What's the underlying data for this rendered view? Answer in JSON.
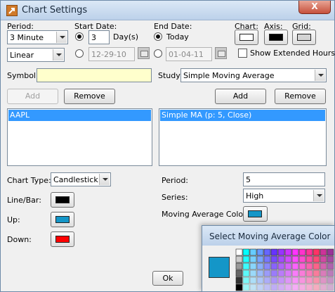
{
  "window": {
    "title": "Chart Settings",
    "close_glyph": "X"
  },
  "period": {
    "label": "Period:",
    "value": "3 Minute",
    "scale_value": "Linear"
  },
  "start_date": {
    "label": "Start Date:",
    "days_value": "3",
    "days_label": "Day(s)",
    "date_value": "12-29-10"
  },
  "end_date": {
    "label": "End Date:",
    "today_label": "Today",
    "date_value": "01-04-11"
  },
  "colors_header": {
    "chart_label": "Chart:",
    "axis_label": "Axis:",
    "grid_label": "Grid:",
    "chart_color": "#ffffff",
    "axis_color": "#000000",
    "grid_color": "#d4d4d4"
  },
  "extended_hours": {
    "label": "Show Extended Hours",
    "checked": false
  },
  "symbol": {
    "label": "Symbol:",
    "value": "",
    "add_label": "Add",
    "remove_label": "Remove",
    "items": [
      "AAPL"
    ]
  },
  "study": {
    "label": "Study:",
    "value": "Simple Moving Average",
    "add_label": "Add",
    "remove_label": "Remove",
    "items": [
      "Simple MA (p: 5, Close)"
    ]
  },
  "chart_type": {
    "label": "Chart Type:",
    "value": "Candlestick"
  },
  "line_bar": {
    "label": "Line/Bar:",
    "color": "#000000"
  },
  "up": {
    "label": "Up:",
    "color": "#1496c8"
  },
  "down": {
    "label": "Down:",
    "color": "#ff0000"
  },
  "study_params": {
    "period_label": "Period:",
    "period_value": "5",
    "series_label": "Series:",
    "series_value": "High",
    "ma_color_label": "Moving Average Color:",
    "ma_color": "#1496c8"
  },
  "ok_label": "Ok",
  "color_popup": {
    "title": "Select Moving Average Color",
    "current_color": "#1496c8"
  }
}
